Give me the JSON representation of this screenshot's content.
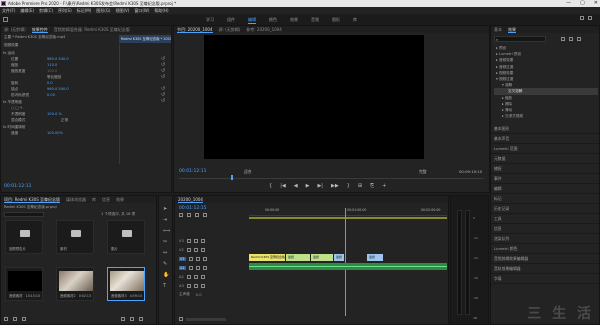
{
  "window": {
    "title": "Adobe Premiere Pro 2020 - F:\\康丹\\Redmi K30S发布会\\Redmi K30S 至尊纪念版.prproj *",
    "controls": [
      "—",
      "▢",
      "✕"
    ]
  },
  "menu": [
    "文件(F)",
    "编辑(E)",
    "剪辑(C)",
    "序列(S)",
    "标记(M)",
    "图形(G)",
    "视图(V)",
    "窗口(W)",
    "帮助(H)"
  ],
  "workspaces": {
    "tabs": [
      "学习",
      "组件",
      "编辑",
      "颜色",
      "效果",
      "音频",
      "图形",
      "库"
    ],
    "active_index": 2
  },
  "effect_controls": {
    "tabs": [
      "源: (无剪辑)",
      "效果控件",
      "音频剪辑混合器: Redmi K30S 至尊纪念版",
      "元数据"
    ],
    "active_index": 1,
    "clip_path": "主要 * Redmi K30S 至尊纪念版.mp4",
    "sequence_label": "Redmi K30S 至尊纪念版 * 20200_1004",
    "mini_tab": "视频效果",
    "rows": [
      {
        "label": "fx  运动",
        "value": ""
      },
      {
        "label": "位置",
        "value": "960.0   540.0"
      },
      {
        "label": "缩放",
        "value": "110.0"
      },
      {
        "label": "缩放宽度",
        "value": "100.0"
      },
      {
        "label": "",
        "value": "等比缩放"
      },
      {
        "label": "旋转",
        "value": "0.0"
      },
      {
        "label": "锚点",
        "value": "960.0   540.0"
      },
      {
        "label": "防闪烁滤镜",
        "value": "0.00"
      },
      {
        "label": "fx  不透明度",
        "value": ""
      },
      {
        "label": "",
        "value": "○ □ ✎"
      },
      {
        "label": "不透明度",
        "value": "100.0 %"
      },
      {
        "label": "混合模式",
        "value": "正常"
      },
      {
        "label": "fx  时间重映射",
        "value": ""
      },
      {
        "label": "速度",
        "value": "100.00%"
      }
    ],
    "timecode": "00:01:12:11"
  },
  "program_monitor": {
    "tabs": [
      "节目: 20200_1004",
      "源: (无剪辑)",
      "参考: 20200_1004"
    ],
    "active_index": 0,
    "timecode_left": "00:01:12:11",
    "fit": "适合",
    "quality": "完整",
    "timecode_right": "00:09:19:10",
    "controls": [
      "{",
      "|◀",
      "◀",
      "▶",
      "▶|",
      "▶▶",
      "}",
      "⊞",
      "⎘",
      "+"
    ]
  },
  "project": {
    "tabs": [
      "项目: Redmi K30S 至尊纪念版",
      "媒体浏览器",
      "库",
      "信息",
      "效果"
    ],
    "active_index": 0,
    "filename": "Redmi K30S 至尊纪念版.prproj",
    "count": "1 个项选中, 共 16 项",
    "items": [
      {
        "name": "回顾预告片",
        "dur": "",
        "kind": "folder"
      },
      {
        "name": "素材",
        "dur": "",
        "kind": "folder"
      },
      {
        "name": "图片",
        "dur": "",
        "kind": "folder"
      },
      {
        "name": "音频素材",
        "dur": "10:15:10",
        "kind": "black"
      },
      {
        "name": "音频素材2",
        "dur": "0:02:13",
        "kind": "photo"
      },
      {
        "name": "音频素材3",
        "dur": "4:59:10",
        "kind": "photo2"
      }
    ]
  },
  "timeline": {
    "tab": "20200_1004",
    "timecode": "00:01:12:15",
    "ruler": [
      "00:00:00",
      "00:01:00:00",
      "00:02:00:00"
    ],
    "video_tracks": [
      "V3",
      "V2",
      "V1"
    ],
    "audio_tracks": [
      "A1",
      "A2",
      "A3"
    ],
    "master": "主声道",
    "master_value": "0.0",
    "clips_v1": [
      "Redmi K30S 至尊纪念版",
      "最终",
      "最终",
      "最终",
      "最终"
    ],
    "tool_icons": [
      "select-icon",
      "track-select-icon",
      "ripple-icon",
      "razor-icon",
      "slip-icon",
      "pen-icon",
      "hand-icon",
      "type-icon"
    ]
  },
  "meters": {
    "scale": [
      "0",
      "-12",
      "-24",
      "-36",
      "-48",
      "dB"
    ]
  },
  "effects_panel": {
    "tabs": [
      "基本",
      "效果"
    ],
    "search_placeholder": "",
    "tree": [
      "预设",
      "Lumetri 预设",
      "音频效果",
      "音频过渡",
      "视频效果",
      "视频过渡",
      "溶解",
      "交叉溶解",
      "缩放",
      "擦除",
      "滑动",
      "沉浸式视频"
    ],
    "sections": [
      "基本图形",
      "基本声音",
      "Lumetri 范围",
      "元数据",
      "捕捉",
      "事件",
      "编辑",
      "标记",
      "历史记录",
      "工具",
      "信息",
      "渲染队列",
      "Lumetri 颜色",
      "音频剪辑效果编辑器",
      "音轨效果编辑器",
      "字幕"
    ]
  },
  "watermark": "三 生 活"
}
